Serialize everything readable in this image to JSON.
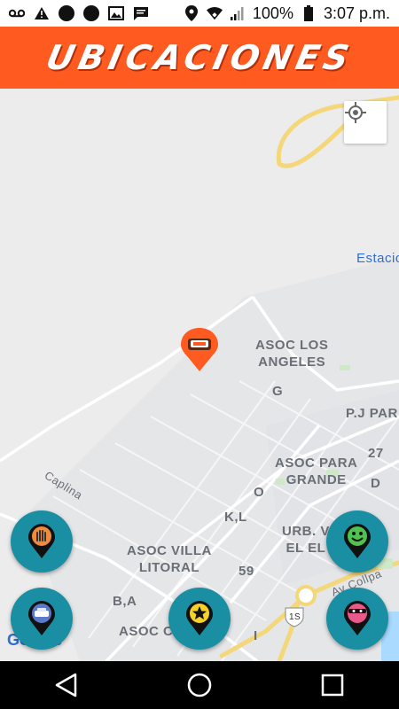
{
  "status_bar": {
    "battery_text": "100%",
    "time": "3:07 p.m.",
    "icons": [
      "voicemail-icon",
      "warning-icon",
      "circle-icon",
      "circle-icon",
      "image-icon",
      "message-icon",
      "location-icon",
      "wifi-icon",
      "signal-icon",
      "battery-icon"
    ]
  },
  "header": {
    "title": "UBICACIONES",
    "color": "#ff5a1f"
  },
  "map": {
    "labels": {
      "asoc_los_angeles": "ASOC LOS\nANGELES",
      "g": "G",
      "pj_par": "P.J PAR",
      "n27": "27",
      "asoc_para_grande": "ASOC PARA\nGRANDE",
      "d": "D",
      "o": "O",
      "kl": "K,L",
      "urb_v_el_el": "URB. V\nEL EL",
      "asoc_villa_litoral": "ASOC VILLA\nLITORAL",
      "n59": "59",
      "ba": "B,A",
      "asoc_c": "ASOC C",
      "i": "I",
      "estacio": "Estacio",
      "k": "K",
      "caplina": "Caplina",
      "av_collpa": "Av Collpa",
      "n1s": "1S",
      "google": "Google"
    }
  },
  "fab_colors": {
    "teal": "#1a8fa4"
  }
}
